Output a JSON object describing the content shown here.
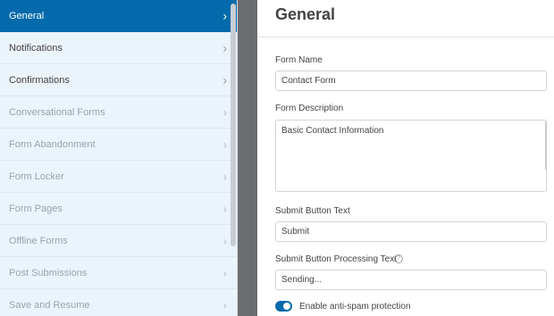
{
  "sidebar": {
    "items": [
      {
        "label": "General",
        "state": "active"
      },
      {
        "label": "Notifications",
        "state": "enabled"
      },
      {
        "label": "Confirmations",
        "state": "enabled"
      },
      {
        "label": "Conversational Forms",
        "state": "disabled"
      },
      {
        "label": "Form Abandonment",
        "state": "disabled"
      },
      {
        "label": "Form Locker",
        "state": "disabled"
      },
      {
        "label": "Form Pages",
        "state": "disabled"
      },
      {
        "label": "Offline Forms",
        "state": "disabled"
      },
      {
        "label": "Post Submissions",
        "state": "disabled"
      },
      {
        "label": "Save and Resume",
        "state": "disabled"
      }
    ],
    "chevron_icon": "chevron-right-icon"
  },
  "panel": {
    "title": "General",
    "form_name": {
      "label": "Form Name",
      "value": "Contact Form"
    },
    "form_description": {
      "label": "Form Description",
      "value": "Basic Contact Information"
    },
    "submit_text": {
      "label": "Submit Button Text",
      "value": "Submit"
    },
    "processing_text": {
      "label": "Submit Button Processing Text",
      "value": "Sending...",
      "help_icon": "help-circle-icon"
    },
    "anti_spam": {
      "label": "Enable anti-spam protection",
      "enabled": true
    }
  },
  "colors": {
    "accent": "#036aab",
    "sidebar_bg": "#ebf3fb",
    "divider": "#6b6d70",
    "text": "#444444",
    "disabled_text": "#9aa3ad"
  }
}
